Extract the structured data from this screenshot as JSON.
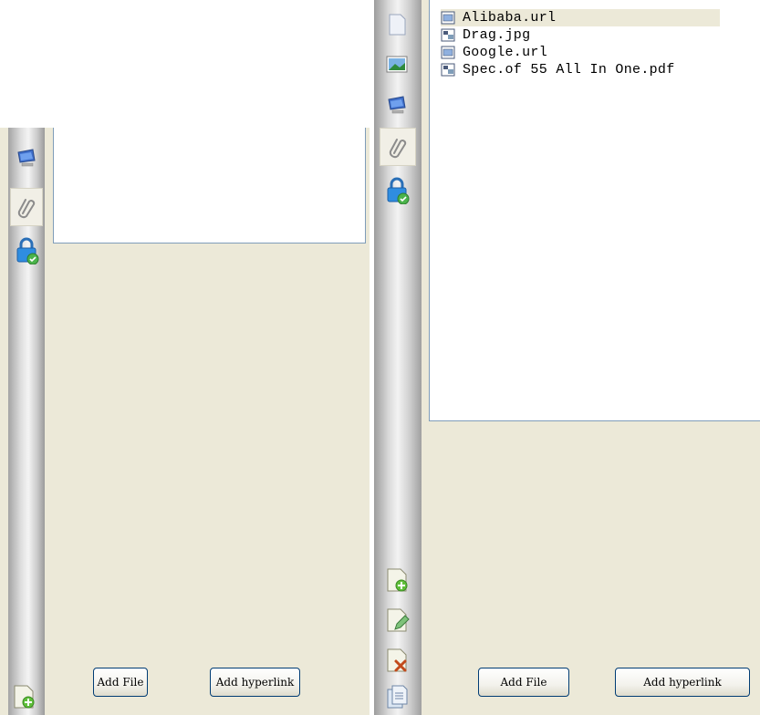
{
  "left_panel": {
    "add_file_label": "Add File",
    "add_hyperlink_label": "Add hyperlink"
  },
  "right_panel": {
    "files": [
      {
        "name": "Alibaba.url",
        "icon": "url-file-icon",
        "selected": true
      },
      {
        "name": "Drag.jpg",
        "icon": "image-file-icon",
        "selected": false
      },
      {
        "name": "Google.url",
        "icon": "url-file-icon",
        "selected": false
      },
      {
        "name": "Spec.of 55 All In One.pdf",
        "icon": "pdf-file-icon",
        "selected": false
      }
    ],
    "add_file_label": "Add File",
    "add_hyperlink_label": "Add hyperlink"
  },
  "colors": {
    "panel_bg": "#ece9d8",
    "border": "#7f9db9",
    "selection": "#ece9d8",
    "button_border": "#003c74"
  }
}
